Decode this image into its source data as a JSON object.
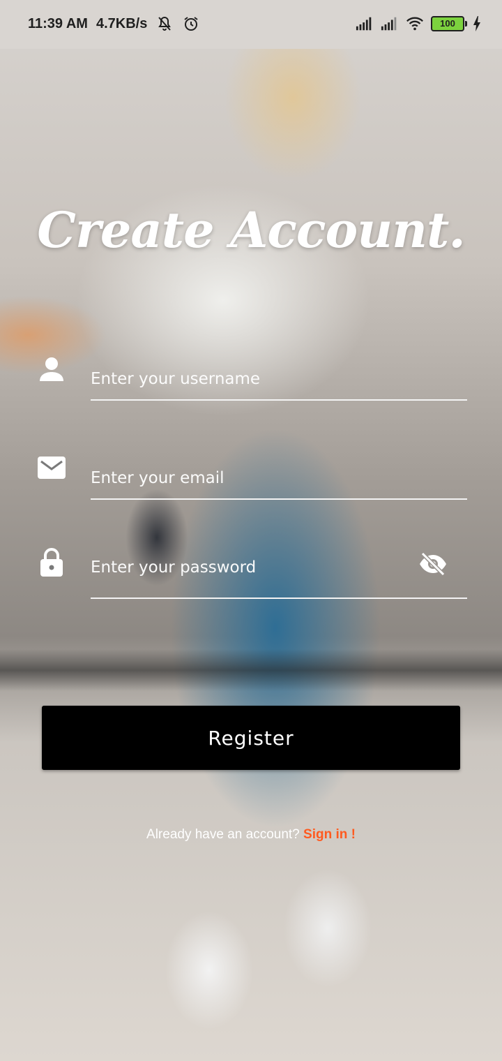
{
  "status_bar": {
    "time": "11:39 AM",
    "speed": "4.7KB/s",
    "battery": "100",
    "icons": [
      "bell-off-icon",
      "alarm-icon",
      "signal-icon",
      "signal-icon",
      "wifi-icon",
      "charging-icon"
    ]
  },
  "title": "Create Account.",
  "form": {
    "username": {
      "placeholder": "Enter your username",
      "icon": "person-icon"
    },
    "email": {
      "placeholder": "Enter your email",
      "icon": "mail-icon"
    },
    "password": {
      "placeholder": "Enter your password",
      "icon": "lock-icon",
      "toggle_icon": "eye-off-icon"
    }
  },
  "register_label": "Register",
  "footer": {
    "prompt": "Already have an account? ",
    "link": "Sign in !"
  },
  "colors": {
    "link": "#ff5a1f",
    "button": "#000000",
    "text": "#ffffff"
  }
}
